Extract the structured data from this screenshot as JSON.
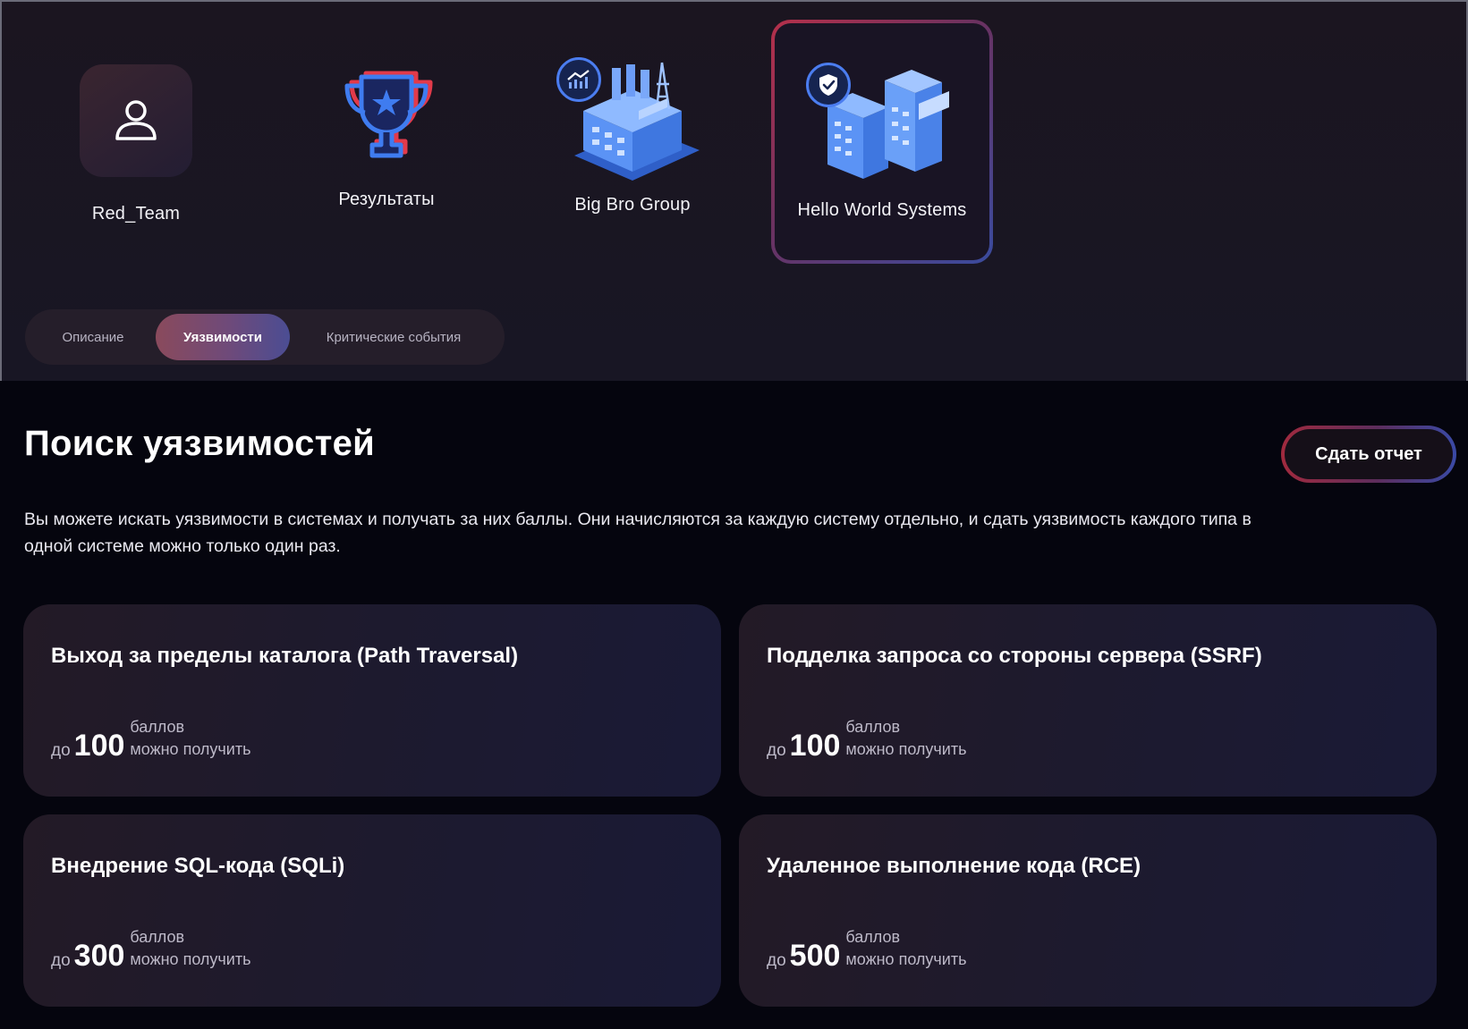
{
  "nav": {
    "team": {
      "label": "Red_Team",
      "icon": "user-icon"
    },
    "results": {
      "label": "Результаты",
      "icon": "trophy-icon"
    },
    "systems": [
      {
        "label": "Big Bro Group",
        "icon": "chart-badge-icon",
        "selected": false
      },
      {
        "label": "Hello World Systems",
        "icon": "shield-check-badge-icon",
        "selected": true
      }
    ]
  },
  "tabs": [
    {
      "label": "Описание",
      "active": false
    },
    {
      "label": "Уязвимости",
      "active": true
    },
    {
      "label": "Критические события",
      "active": false
    }
  ],
  "main": {
    "title": "Поиск уязвимостей",
    "report_button": "Сдать отчет",
    "intro": "Вы можете искать уязвимости в системах и получать за них баллы. Они начисляются за каждую систему отдельно, и сдать уязвимость каждого типа в одной системе можно только один раз."
  },
  "cards": [
    {
      "title": "Выход за пределы каталога (Path Traversal)",
      "prefix": "до",
      "points": "100",
      "unit": "баллов",
      "caption": "можно получить"
    },
    {
      "title": "Подделка запроса со стороны сервера (SSRF)",
      "prefix": "до",
      "points": "100",
      "unit": "баллов",
      "caption": "можно получить"
    },
    {
      "title": "Внедрение SQL-кода (SQLi)",
      "prefix": "до",
      "points": "300",
      "unit": "баллов",
      "caption": "можно получить"
    },
    {
      "title": "Удаленное выполнение кода (RCE)",
      "prefix": "до",
      "points": "500",
      "unit": "баллов",
      "caption": "можно получить"
    }
  ],
  "colors": {
    "background": "#05050e",
    "band": "#1b1520",
    "accent_red": "#b5304a",
    "accent_blue": "#3a4b9e",
    "illustration_blue": "#5aa0ff"
  }
}
